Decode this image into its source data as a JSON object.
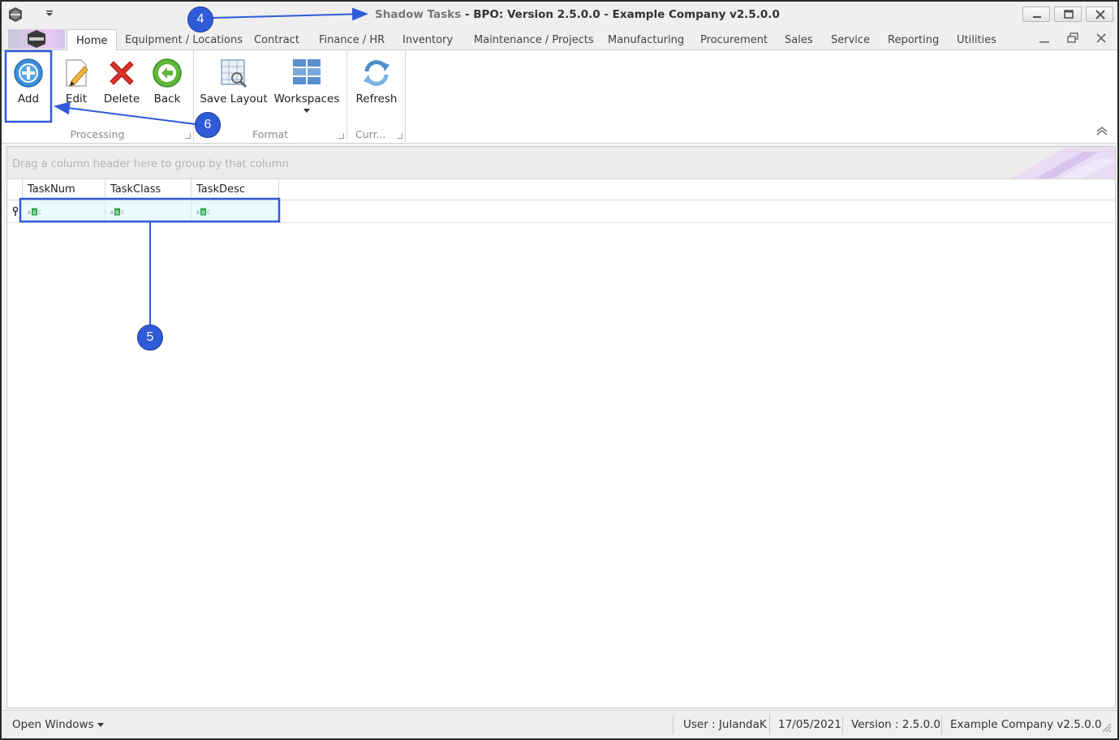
{
  "window": {
    "title_doc": "Shadow Tasks",
    "title_app": "- BPO: Version 2.5.0.0 - Example Company v2.5.0.0"
  },
  "tabs": {
    "home": "Home",
    "items": [
      "Equipment / Locations",
      "Contract",
      "Finance / HR",
      "Inventory",
      "Maintenance / Projects",
      "Manufacturing",
      "Procurement",
      "Sales",
      "Service",
      "Reporting",
      "Utilities"
    ]
  },
  "ribbon": {
    "processing": {
      "label": "Processing",
      "add": "Add",
      "edit": "Edit",
      "delete": "Delete",
      "back": "Back"
    },
    "format": {
      "label": "Format",
      "save_layout": "Save Layout",
      "workspaces": "Workspaces"
    },
    "current": {
      "label": "Curr...",
      "refresh": "Refresh"
    }
  },
  "grid": {
    "group_panel_hint": "Drag a column header here to group by that column",
    "columns": [
      "TaskNum",
      "TaskClass",
      "TaskDesc"
    ]
  },
  "statusbar": {
    "open_windows": "Open Windows",
    "user": "User : JulandaK",
    "date": "17/05/2021",
    "version": "Version : 2.5.0.0",
    "company": "Example Company v2.5.0.0"
  },
  "annotations": [
    "4",
    "5",
    "6"
  ],
  "colors": {
    "annotation": "#2f5bd8",
    "filter_row": "#e9fbff",
    "delete_red": "#d9322b",
    "back_green": "#5fb83a",
    "add_blue": "#3b8fd9"
  }
}
